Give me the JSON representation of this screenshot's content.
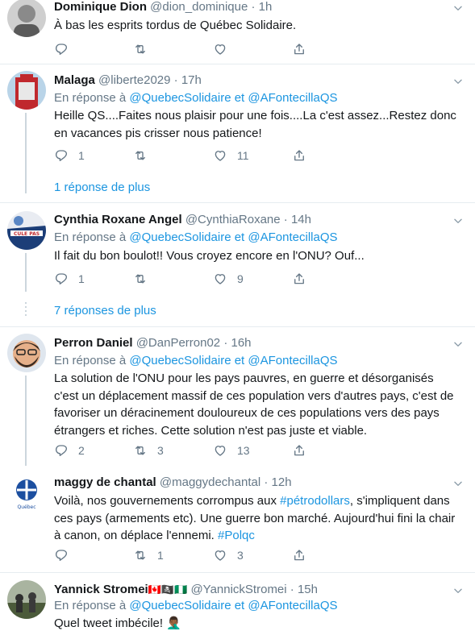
{
  "tweets": [
    {
      "name": "Dominique Dion",
      "handle": "@dion_dominique",
      "time": "1h",
      "text": "À bas les esprits tordus de Québec Solidaire.",
      "reply_count": "",
      "retweet_count": "",
      "like_count": ""
    },
    {
      "name": "Malaga",
      "handle": "@liberte2029",
      "time": "17h",
      "reply_prefix": "En réponse à",
      "mention1": "@QuebecSolidaire",
      "conj": "et",
      "mention2": "@AFontecillaQS",
      "text": "Heille QS....Faites nous plaisir pour une fois....La c'est assez...Restez donc en vacances pis crisser nous patience!",
      "reply_count": "1",
      "retweet_count": "",
      "like_count": "11",
      "more_replies": "1 réponse de plus"
    },
    {
      "name": "Cynthia Roxane Angel",
      "handle": "@CynthiaRoxane",
      "time": "14h",
      "reply_prefix": "En réponse à",
      "mention1": "@QuebecSolidaire",
      "conj": "et",
      "mention2": "@AFontecillaQS",
      "text": "Il fait du bon boulot!! Vous croyez encore en l'ONU? Ouf...",
      "reply_count": "1",
      "retweet_count": "",
      "like_count": "9",
      "more_replies": "7 réponses de plus"
    },
    {
      "name": "Perron Daniel",
      "handle": "@DanPerron02",
      "time": "16h",
      "reply_prefix": "En réponse à",
      "mention1": "@QuebecSolidaire",
      "conj": "et",
      "mention2": "@AFontecillaQS",
      "text": "La solution de l'ONU pour les pays pauvres, en guerre et désorganisés c'est un déplacement massif de ces population vers d'autres pays, c'est de favoriser un déracinement douloureux de ces populations vers des pays étrangers et riches. Cette solution n'est pas juste et viable.",
      "reply_count": "2",
      "retweet_count": "3",
      "like_count": "13"
    },
    {
      "name": "maggy de chantal",
      "handle": "@maggydechantal",
      "time": "12h",
      "text_a": "Voilà, nos gouvernements corrompus aux ",
      "link1": "#pétrodollars",
      "text_b": ", s'impliquent dans ces pays (armements etc). Une guerre bon marché. Aujourd'hui fini la chair à canon, on déplace l'ennemi. ",
      "link2": "#Polqc",
      "reply_count": "",
      "retweet_count": "1",
      "like_count": "3"
    },
    {
      "name": "Yannick Stromei",
      "name_emoji": "🇨🇦🏴‍☠️🇳🇬",
      "handle": "@YannickStromei",
      "time": "15h",
      "reply_prefix": "En réponse à",
      "mention1": "@QuebecSolidaire",
      "conj": "et",
      "mention2": "@AFontecillaQS",
      "text": "Quel tweet imbécile!",
      "text_emoji": "🤦🏾‍♂️"
    }
  ],
  "dot": "·",
  "icons": [
    "reply-icon",
    "retweet-icon",
    "like-icon",
    "share-icon",
    "chevron-down-icon"
  ]
}
